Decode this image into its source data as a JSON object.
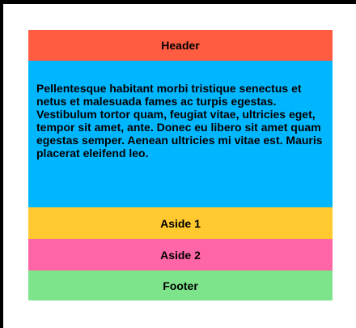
{
  "layout": {
    "header": "Header",
    "main_text": "Pellentesque habitant morbi tristique senectus et netus et malesuada fames ac turpis egestas. Vestibulum tortor quam, feugiat vitae, ultricies eget, tempor sit amet, ante. Donec eu libero sit amet quam egestas semper. Aenean ultricies mi vitae est. Mauris placerat eleifend leo.",
    "aside_1": "Aside 1",
    "aside_2": "Aside 2",
    "footer": "Footer"
  },
  "colors": {
    "header": "#ff5c42",
    "main": "#00b7ff",
    "aside_1": "#ffc92f",
    "aside_2": "#ff66a8",
    "footer": "#7ee48c"
  }
}
